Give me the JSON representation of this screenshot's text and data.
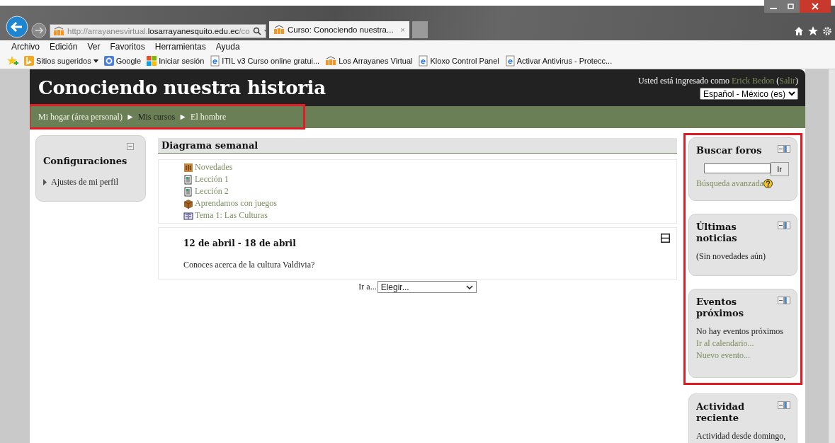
{
  "browser": {
    "address": {
      "prefix": "http://arrayanesvirtual.",
      "domain": "losarrayanesquito.edu.ec",
      "suffix": "/co"
    },
    "tabs": [
      {
        "title": "Curso: Conociendo nuestra...",
        "close": "×",
        "selected": true
      }
    ],
    "menu": [
      "Archivo",
      "Edición",
      "Ver",
      "Favoritos",
      "Herramientas",
      "Ayuda"
    ],
    "favorites": [
      {
        "label": "Sitios sugeridos",
        "kind": "bing",
        "has_menu": true
      },
      {
        "label": "Google",
        "kind": "google",
        "has_menu": false
      },
      {
        "label": "Iniciar sesión",
        "kind": "windows",
        "has_menu": false
      },
      {
        "label": "ITIL v3 Curso online gratui...",
        "kind": "ie",
        "has_menu": false
      },
      {
        "label": "Los Arrayanes Virtual",
        "kind": "moodle",
        "has_menu": false
      },
      {
        "label": "Kloxo Control Panel",
        "kind": "ie",
        "has_menu": false
      },
      {
        "label": "Activar Antivirus - Protecc...",
        "kind": "ie",
        "has_menu": false
      }
    ]
  },
  "page": {
    "title": "Conociendo nuestra historia",
    "login": [
      {
        "text": "Usted está ingresado como ",
        "link": false
      },
      {
        "text": "Erick Bedon",
        "link": true
      },
      {
        "text": " (",
        "link": false
      },
      {
        "text": "Salir",
        "link": true
      },
      {
        "text": ")",
        "link": false
      }
    ],
    "language": "Español - México (es)",
    "breadcrumb": {
      "highlighted": true,
      "items": [
        {
          "label": "Mi hogar (área personal)",
          "link": true
        },
        {
          "separator": "►",
          "label": "Mis cursos",
          "link": false
        },
        {
          "separator": "►",
          "label": "El hombre",
          "link": true
        }
      ]
    },
    "left_blocks": [
      {
        "title": "Configuraciones",
        "items": [
          {
            "label": "Ajustes de mi perfil",
            "expanded": false
          }
        ]
      }
    ],
    "course": {
      "heading": "Diagrama semanal",
      "activities": [
        {
          "label": "Novedades",
          "kind": "forum"
        },
        {
          "label": "Lección 1",
          "kind": "page"
        },
        {
          "label": "Lección 2",
          "kind": "page"
        },
        {
          "label": "Aprendamos con juegos",
          "kind": "package"
        },
        {
          "label": "Tema 1: Las Culturas",
          "kind": "book"
        }
      ],
      "sections": [
        {
          "title": "12 de abril - 18 de abril",
          "summary": "Conoces acerca de la cultura Valdivia?"
        }
      ],
      "jump": {
        "label": "Ir a...",
        "value": "Elegir..."
      }
    },
    "right_blocks": {
      "highlighted": true,
      "framed_blocks": [
        {
          "kind": "search",
          "title": "Buscar foros",
          "button": "Ir",
          "link": "Búsqueda avanzada"
        },
        {
          "kind": "text",
          "title": "Últimas noticias",
          "lines": [
            {
              "text": "(Sin novedades aún)",
              "link": false
            }
          ]
        },
        {
          "kind": "text",
          "title": "Eventos próximos",
          "lines": [
            {
              "text": "No hay eventos próximos",
              "link": false
            },
            {
              "text": "Ir al calendario...",
              "link": true
            },
            {
              "text": "Nuevo evento...",
              "link": true
            }
          ]
        }
      ],
      "blocks": [
        {
          "kind": "text",
          "title": "Actividad reciente",
          "lines": [
            {
              "text": "Actividad desde domingo,",
              "link": false
            }
          ]
        }
      ]
    }
  }
}
